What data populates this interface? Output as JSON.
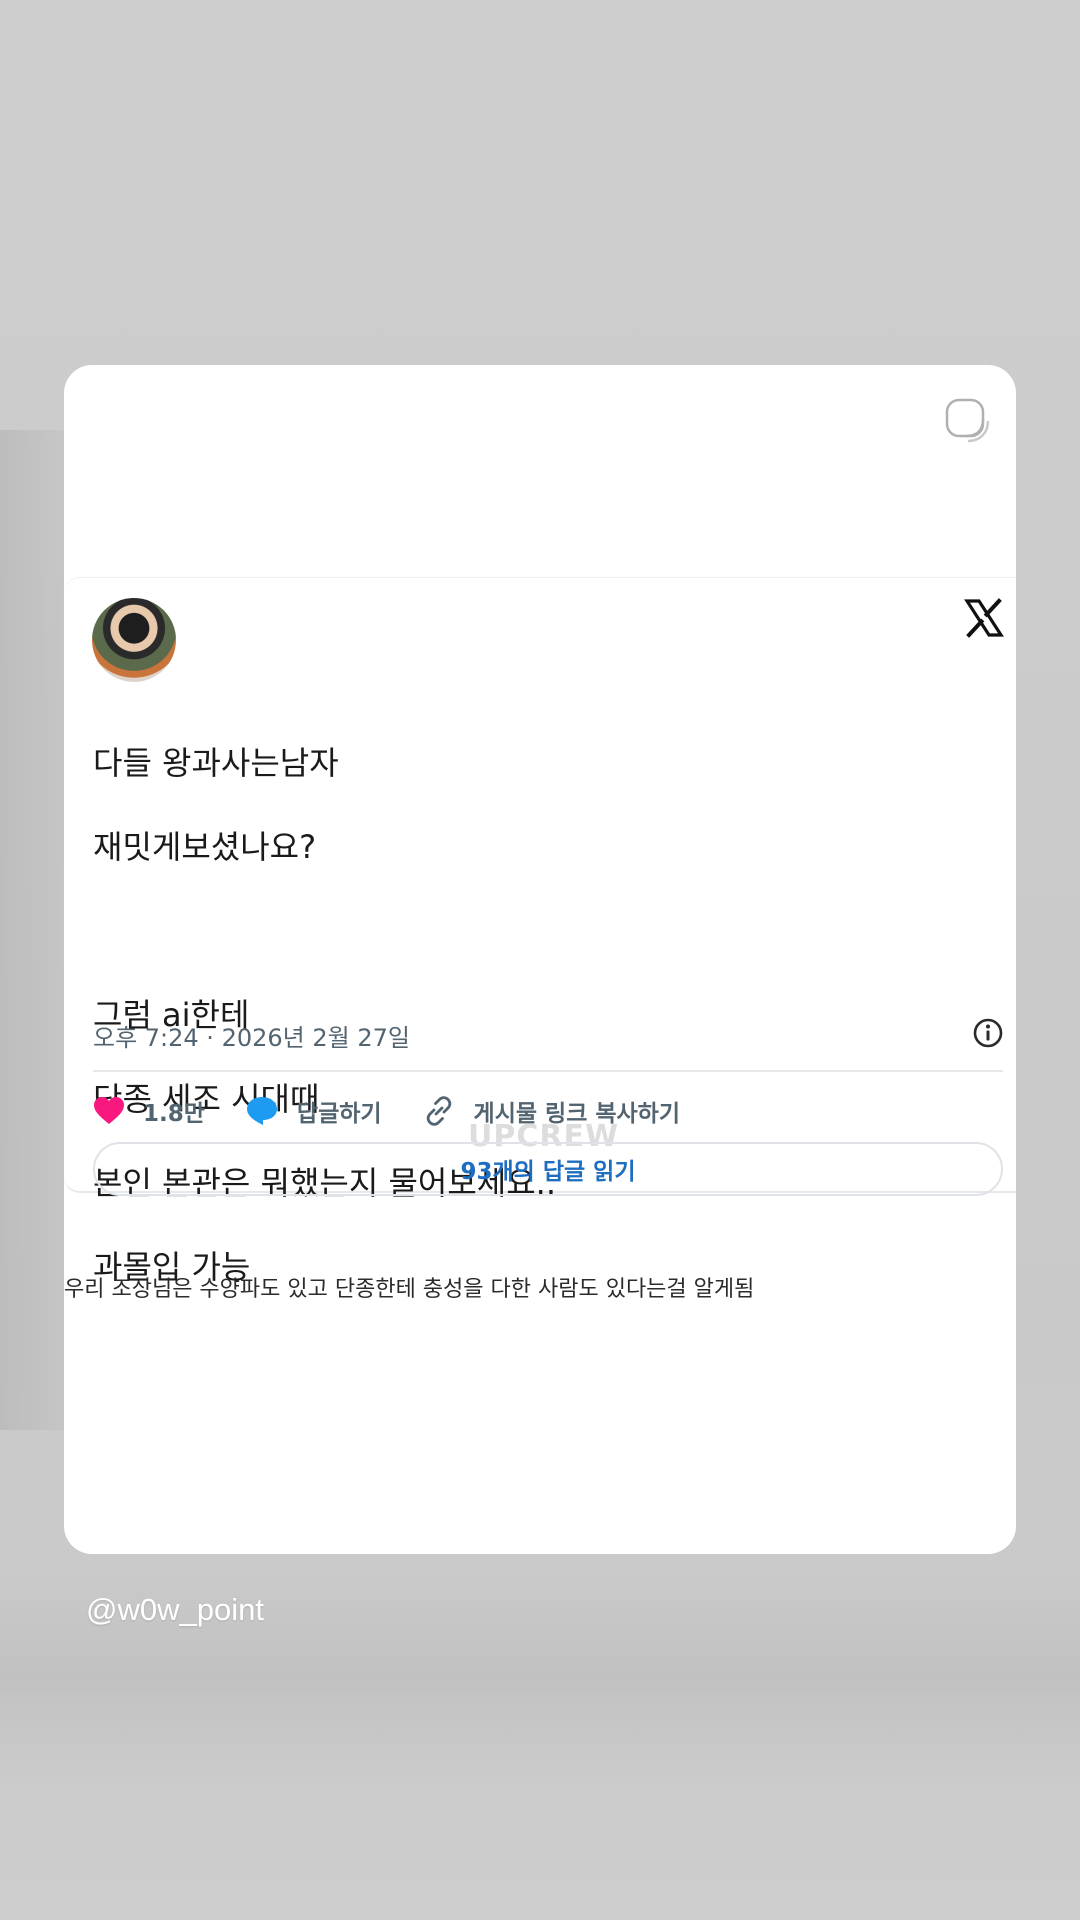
{
  "tweet": {
    "lines_1": [
      "다들 왕과사는남자",
      "재밋게보셨나요?"
    ],
    "lines_2": [
      "그럼 ai한테",
      "단종 세조 시대때",
      "본인 본관은 뭐했는지 물어보세요..",
      "과몰입 가능"
    ],
    "timestamp": "오후 7:24 · 2026년 2월 27일",
    "likes": "1.8만",
    "reply_label": "답글하기",
    "copy_link_label": "게시물 링크 복사하기",
    "read_replies_label": "93개의 답글 읽기",
    "watermark": "UPCREW"
  },
  "caption": "우리 조상님은 수양파도 있고 단종한테 충성을 다한 사람도 있다는걸 알게됨",
  "handle": "@w0w_point",
  "colors": {
    "like": "#f91880",
    "reply": "#1d9bf0",
    "link_text": "#1d6ec0",
    "muted": "#536471"
  },
  "icons": [
    "sticker-icon",
    "x-logo-icon",
    "info-icon",
    "heart-icon",
    "speech-bubble-icon",
    "link-icon"
  ]
}
